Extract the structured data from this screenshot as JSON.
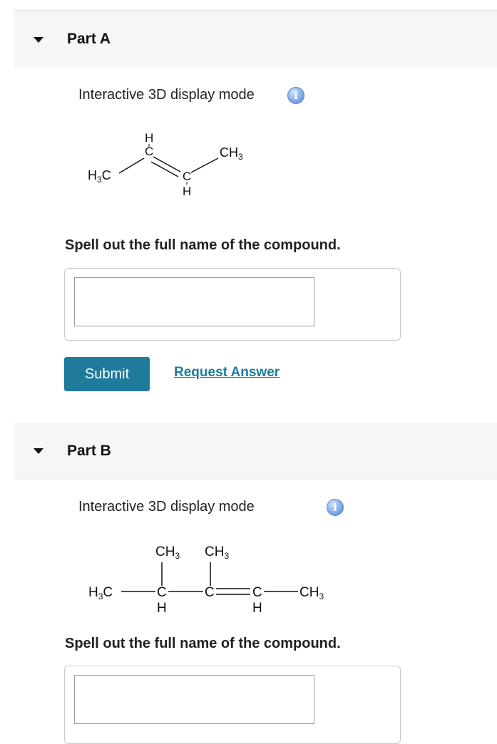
{
  "partA": {
    "title": "Part A",
    "display_mode_label": "Interactive 3D display mode",
    "info_icon_glyph": "i",
    "question": "Spell out the full name of the compound.",
    "answer_value": "",
    "submit_label": "Submit",
    "request_answer_label": "Request Answer",
    "molecule": {
      "left_group": {
        "main": "H",
        "sub": "3",
        "tail": "C"
      },
      "right_group": {
        "main": "CH",
        "sub": "3"
      },
      "upper_carbon": "C",
      "upper_h": "H",
      "lower_carbon": "C",
      "lower_h": "H"
    }
  },
  "partB": {
    "title": "Part B",
    "display_mode_label": "Interactive 3D display mode",
    "info_icon_glyph": "i",
    "question": "Spell out the full name of the compound.",
    "answer_value": "",
    "molecule": {
      "left_group": {
        "main": "H",
        "sub": "3",
        "tail": "C"
      },
      "c2": "C",
      "c2_h": "H",
      "c2_branch": {
        "main": "CH",
        "sub": "3"
      },
      "c3": "C",
      "c3_branch": {
        "main": "CH",
        "sub": "3"
      },
      "c4": "C",
      "c4_h": "H",
      "right_group": {
        "main": "CH",
        "sub": "3"
      }
    }
  },
  "colors": {
    "accent": "#1f7b9c",
    "header_bg": "#f6f6f6",
    "info_icon": "#4f86d4"
  },
  "icons": {
    "collapse": "caret-down-icon",
    "info": "info-icon"
  }
}
